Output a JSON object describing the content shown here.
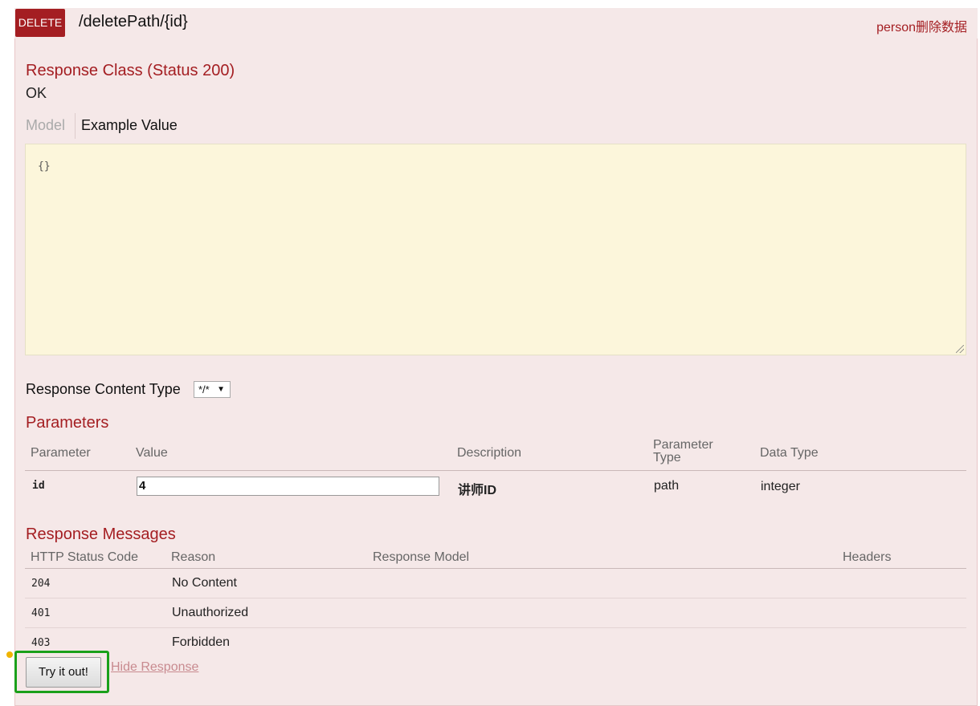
{
  "operation": {
    "method": "DELETE",
    "path": "/deletePath/{id}",
    "summary": "person删除数据"
  },
  "response_class": {
    "title": "Response Class (Status 200)",
    "status_text": "OK",
    "tabs": [
      "Model",
      "Example Value"
    ],
    "example_value": "{}"
  },
  "response_content_type": {
    "label": "Response Content Type",
    "selected": "*/*",
    "arrow": "▼"
  },
  "parameters": {
    "title": "Parameters",
    "headers": [
      "Parameter",
      "Value",
      "Description",
      "Parameter\nType",
      "Data Type"
    ],
    "rows": [
      {
        "name": "id",
        "value": "4",
        "description": "讲师ID",
        "param_type": "path",
        "data_type": "integer"
      }
    ]
  },
  "response_messages": {
    "title": "Response Messages",
    "headers": [
      "HTTP Status Code",
      "Reason",
      "Response Model",
      "Headers"
    ],
    "rows": [
      {
        "code": "204",
        "reason": "No Content"
      },
      {
        "code": "401",
        "reason": "Unauthorized"
      },
      {
        "code": "403",
        "reason": "Forbidden"
      }
    ]
  },
  "actions": {
    "try_label": "Try it out!",
    "hide_label": "Hide Response"
  },
  "colors": {
    "method_bg": "#a41e22",
    "panel_bg": "#f5e8e8",
    "snippet_bg": "#fcf6db",
    "highlight": "#1aa01a"
  }
}
